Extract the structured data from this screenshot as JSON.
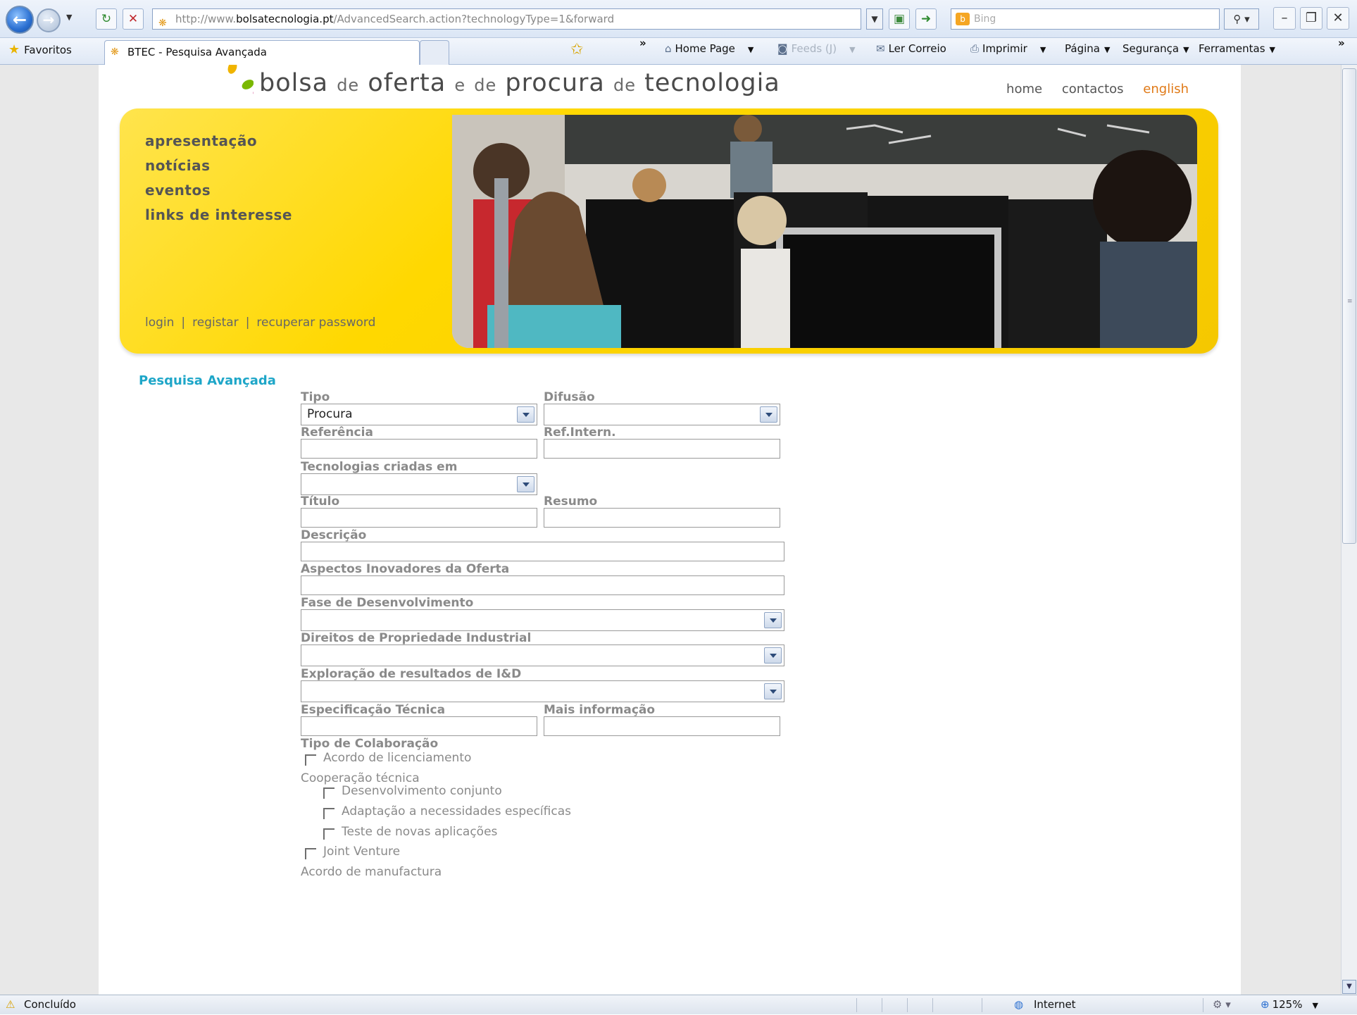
{
  "browser": {
    "address": {
      "prefix": "http://www.",
      "domain": "bolsatecnologia.pt",
      "path": "/AdvancedSearch.action?technologyType=1&forward"
    },
    "search_placeholder": "Bing",
    "favorites_label": "Favoritos",
    "tab_title": "BTEC - Pesquisa Avançada",
    "chevron": "»",
    "commands": {
      "home": "Home Page",
      "feeds": "Feeds (J)",
      "mail": "Ler Correio",
      "print": "Imprimir",
      "page": "Página",
      "safety": "Segurança",
      "tools": "Ferramentas"
    },
    "status": {
      "text": "Concluído",
      "zone": "Internet",
      "zoom": "125%"
    }
  },
  "site": {
    "name": {
      "w1": "bolsa",
      "w2": "de",
      "w3": "oferta",
      "w4": "e",
      "w5": "de",
      "w6": "procura",
      "w7": "de",
      "w8": "tecnologia"
    },
    "top_links": {
      "home": "home",
      "contacts": "contactos",
      "english": "english"
    },
    "menu": [
      "apresentação",
      "notícias",
      "eventos",
      "links de interesse"
    ],
    "auth": {
      "login": "login",
      "register": "registar",
      "recover": "recuperar password",
      "sep": "|"
    }
  },
  "form": {
    "section_title": "Pesquisa Avançada",
    "tipo": {
      "label": "Tipo",
      "value": "Procura"
    },
    "difusao": {
      "label": "Difusão",
      "value": ""
    },
    "referencia": {
      "label": "Referência"
    },
    "ref_intern": {
      "label": "Ref.Intern."
    },
    "tecnologias_criadas": {
      "label": "Tecnologias criadas em",
      "value": ""
    },
    "titulo": {
      "label": "Título"
    },
    "resumo": {
      "label": "Resumo"
    },
    "descricao": {
      "label": "Descrição"
    },
    "aspectos": {
      "label": "Aspectos Inovadores da Oferta"
    },
    "fase": {
      "label": "Fase de Desenvolvimento",
      "value": ""
    },
    "direitos": {
      "label": "Direitos de Propriedade Industrial",
      "value": ""
    },
    "exploracao": {
      "label": "Exploração de resultados de I&D",
      "value": ""
    },
    "especificacao": {
      "label": "Especificação Técnica"
    },
    "mais_info": {
      "label": "Mais informação"
    },
    "colaboracao": {
      "label": "Tipo de Colaboração",
      "licenciamento": "Acordo de licenciamento",
      "cooperacao_group": "Cooperação técnica",
      "desenvolvimento": "Desenvolvimento conjunto",
      "adaptacao": "Adaptação a necessidades específicas",
      "teste": "Teste de novas aplicações",
      "joint_venture": "Joint Venture",
      "manufactura_group": "Acordo de manufactura"
    }
  }
}
